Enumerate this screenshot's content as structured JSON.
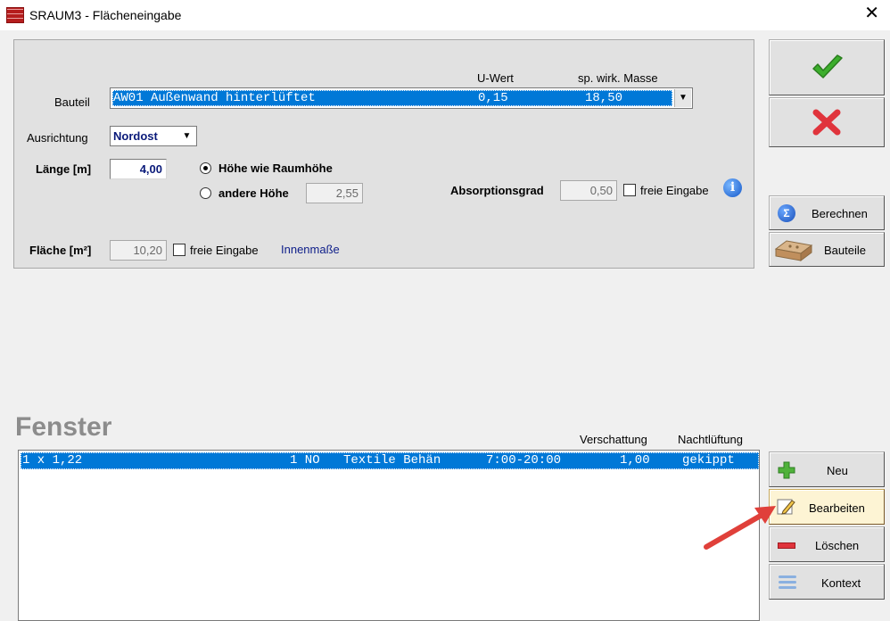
{
  "window": {
    "title": "SRAUM3 - Flächeneingabe",
    "close_glyph": "✕"
  },
  "bauteil": {
    "label": "Bauteil",
    "uwert_header": "U-Wert",
    "masse_header": "sp. wirk. Masse",
    "selected_code_name": "AW01 Außenwand hinterlüftet",
    "selected_uwert": "0,15",
    "selected_masse": "18,50"
  },
  "ausrichtung": {
    "label": "Ausrichtung",
    "value": "Nordost"
  },
  "laenge": {
    "label": "Länge [m]",
    "value": "4,00"
  },
  "hoehe": {
    "option_raumhoehe": "Höhe wie Raumhöhe",
    "option_andere": "andere Höhe",
    "andere_value": "2,55",
    "selected": "raumhoehe"
  },
  "absorption": {
    "label": "Absorptionsgrad",
    "value": "0,50",
    "freie_eingabe_label": "freie Eingabe",
    "freie_eingabe_checked": false
  },
  "flaeche": {
    "label": "Fläche [m²]",
    "value": "10,20",
    "freie_eingabe_label": "freie Eingabe",
    "freie_eingabe_checked": false,
    "link": "Innenmaße"
  },
  "side_buttons": {
    "berechnen": "Berechnen",
    "bauteile": "Bauteile"
  },
  "fenster": {
    "title": "Fenster",
    "col_verschattung": "Verschattung",
    "col_nachtlueftung": "Nachtlüftung",
    "rows": [
      {
        "size": "1 x 1,22",
        "count_orient": "1 NO",
        "shade": "Textile Behän",
        "time": "7:00-20:00",
        "verschattung": "1,00",
        "nachtlueftung": "gekippt"
      }
    ]
  },
  "fenster_buttons": {
    "neu": "Neu",
    "bearbeiten": "Bearbeiten",
    "loeschen": "Löschen",
    "kontext": "Kontext"
  },
  "colors": {
    "selection": "#0078d7",
    "ok_green": "#3cae2c",
    "cancel_red": "#e0343c",
    "annotation_arrow": "#e0403a"
  },
  "icons": [
    "app-icon",
    "checkmark-icon",
    "cross-icon",
    "info-icon",
    "sigma-icon",
    "brick-icon",
    "plus-icon",
    "edit-icon",
    "minus-icon",
    "context-icon"
  ]
}
